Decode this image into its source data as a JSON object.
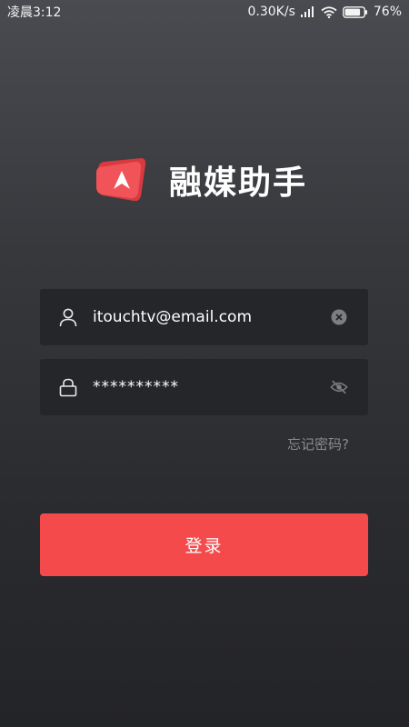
{
  "status_bar": {
    "time": "凌晨3:12",
    "network_speed": "0.30K/s",
    "battery_level": "76%",
    "icons": [
      "signal-icon",
      "wifi-icon",
      "battery-icon"
    ]
  },
  "branding": {
    "app_name": "融媒助手",
    "logo_icon": "app-logo-icon",
    "logo_color": "#f0474c"
  },
  "login_form": {
    "username": {
      "value": "itouchtv@email.com",
      "leading_icon": "user-icon",
      "trailing_icon": "clear-icon"
    },
    "password": {
      "value": "**********",
      "leading_icon": "lock-icon",
      "trailing_icon": "eye-off-icon"
    },
    "forgot_password": "忘记密码?",
    "submit_label": "登录"
  },
  "colors": {
    "accent": "#f54a4c",
    "field_background": "#25262a",
    "muted_text": "#8b8c90"
  }
}
